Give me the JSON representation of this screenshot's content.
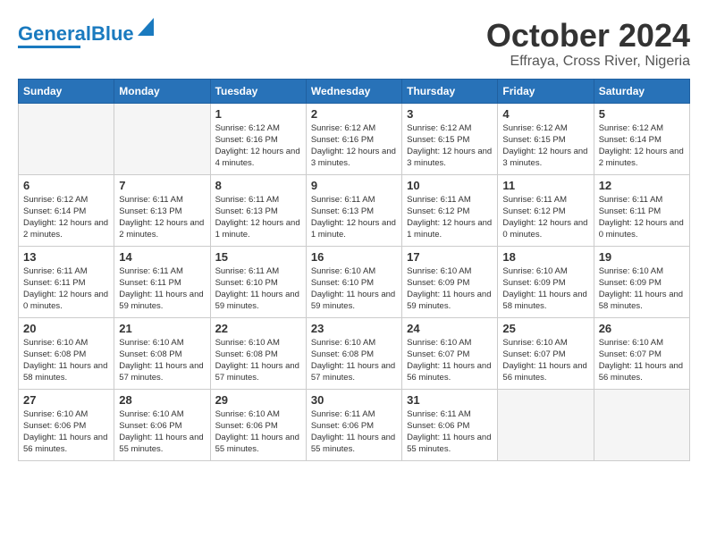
{
  "logo": {
    "line1": "General",
    "line2": "Blue"
  },
  "title": "October 2024",
  "subtitle": "Effraya, Cross River, Nigeria",
  "days_header": [
    "Sunday",
    "Monday",
    "Tuesday",
    "Wednesday",
    "Thursday",
    "Friday",
    "Saturday"
  ],
  "weeks": [
    [
      {
        "num": "",
        "info": ""
      },
      {
        "num": "",
        "info": ""
      },
      {
        "num": "1",
        "info": "Sunrise: 6:12 AM\nSunset: 6:16 PM\nDaylight: 12 hours and 4 minutes."
      },
      {
        "num": "2",
        "info": "Sunrise: 6:12 AM\nSunset: 6:16 PM\nDaylight: 12 hours and 3 minutes."
      },
      {
        "num": "3",
        "info": "Sunrise: 6:12 AM\nSunset: 6:15 PM\nDaylight: 12 hours and 3 minutes."
      },
      {
        "num": "4",
        "info": "Sunrise: 6:12 AM\nSunset: 6:15 PM\nDaylight: 12 hours and 3 minutes."
      },
      {
        "num": "5",
        "info": "Sunrise: 6:12 AM\nSunset: 6:14 PM\nDaylight: 12 hours and 2 minutes."
      }
    ],
    [
      {
        "num": "6",
        "info": "Sunrise: 6:12 AM\nSunset: 6:14 PM\nDaylight: 12 hours and 2 minutes."
      },
      {
        "num": "7",
        "info": "Sunrise: 6:11 AM\nSunset: 6:13 PM\nDaylight: 12 hours and 2 minutes."
      },
      {
        "num": "8",
        "info": "Sunrise: 6:11 AM\nSunset: 6:13 PM\nDaylight: 12 hours and 1 minute."
      },
      {
        "num": "9",
        "info": "Sunrise: 6:11 AM\nSunset: 6:13 PM\nDaylight: 12 hours and 1 minute."
      },
      {
        "num": "10",
        "info": "Sunrise: 6:11 AM\nSunset: 6:12 PM\nDaylight: 12 hours and 1 minute."
      },
      {
        "num": "11",
        "info": "Sunrise: 6:11 AM\nSunset: 6:12 PM\nDaylight: 12 hours and 0 minutes."
      },
      {
        "num": "12",
        "info": "Sunrise: 6:11 AM\nSunset: 6:11 PM\nDaylight: 12 hours and 0 minutes."
      }
    ],
    [
      {
        "num": "13",
        "info": "Sunrise: 6:11 AM\nSunset: 6:11 PM\nDaylight: 12 hours and 0 minutes."
      },
      {
        "num": "14",
        "info": "Sunrise: 6:11 AM\nSunset: 6:11 PM\nDaylight: 11 hours and 59 minutes."
      },
      {
        "num": "15",
        "info": "Sunrise: 6:11 AM\nSunset: 6:10 PM\nDaylight: 11 hours and 59 minutes."
      },
      {
        "num": "16",
        "info": "Sunrise: 6:10 AM\nSunset: 6:10 PM\nDaylight: 11 hours and 59 minutes."
      },
      {
        "num": "17",
        "info": "Sunrise: 6:10 AM\nSunset: 6:09 PM\nDaylight: 11 hours and 59 minutes."
      },
      {
        "num": "18",
        "info": "Sunrise: 6:10 AM\nSunset: 6:09 PM\nDaylight: 11 hours and 58 minutes."
      },
      {
        "num": "19",
        "info": "Sunrise: 6:10 AM\nSunset: 6:09 PM\nDaylight: 11 hours and 58 minutes."
      }
    ],
    [
      {
        "num": "20",
        "info": "Sunrise: 6:10 AM\nSunset: 6:08 PM\nDaylight: 11 hours and 58 minutes."
      },
      {
        "num": "21",
        "info": "Sunrise: 6:10 AM\nSunset: 6:08 PM\nDaylight: 11 hours and 57 minutes."
      },
      {
        "num": "22",
        "info": "Sunrise: 6:10 AM\nSunset: 6:08 PM\nDaylight: 11 hours and 57 minutes."
      },
      {
        "num": "23",
        "info": "Sunrise: 6:10 AM\nSunset: 6:08 PM\nDaylight: 11 hours and 57 minutes."
      },
      {
        "num": "24",
        "info": "Sunrise: 6:10 AM\nSunset: 6:07 PM\nDaylight: 11 hours and 56 minutes."
      },
      {
        "num": "25",
        "info": "Sunrise: 6:10 AM\nSunset: 6:07 PM\nDaylight: 11 hours and 56 minutes."
      },
      {
        "num": "26",
        "info": "Sunrise: 6:10 AM\nSunset: 6:07 PM\nDaylight: 11 hours and 56 minutes."
      }
    ],
    [
      {
        "num": "27",
        "info": "Sunrise: 6:10 AM\nSunset: 6:06 PM\nDaylight: 11 hours and 56 minutes."
      },
      {
        "num": "28",
        "info": "Sunrise: 6:10 AM\nSunset: 6:06 PM\nDaylight: 11 hours and 55 minutes."
      },
      {
        "num": "29",
        "info": "Sunrise: 6:10 AM\nSunset: 6:06 PM\nDaylight: 11 hours and 55 minutes."
      },
      {
        "num": "30",
        "info": "Sunrise: 6:11 AM\nSunset: 6:06 PM\nDaylight: 11 hours and 55 minutes."
      },
      {
        "num": "31",
        "info": "Sunrise: 6:11 AM\nSunset: 6:06 PM\nDaylight: 11 hours and 55 minutes."
      },
      {
        "num": "",
        "info": ""
      },
      {
        "num": "",
        "info": ""
      }
    ]
  ]
}
